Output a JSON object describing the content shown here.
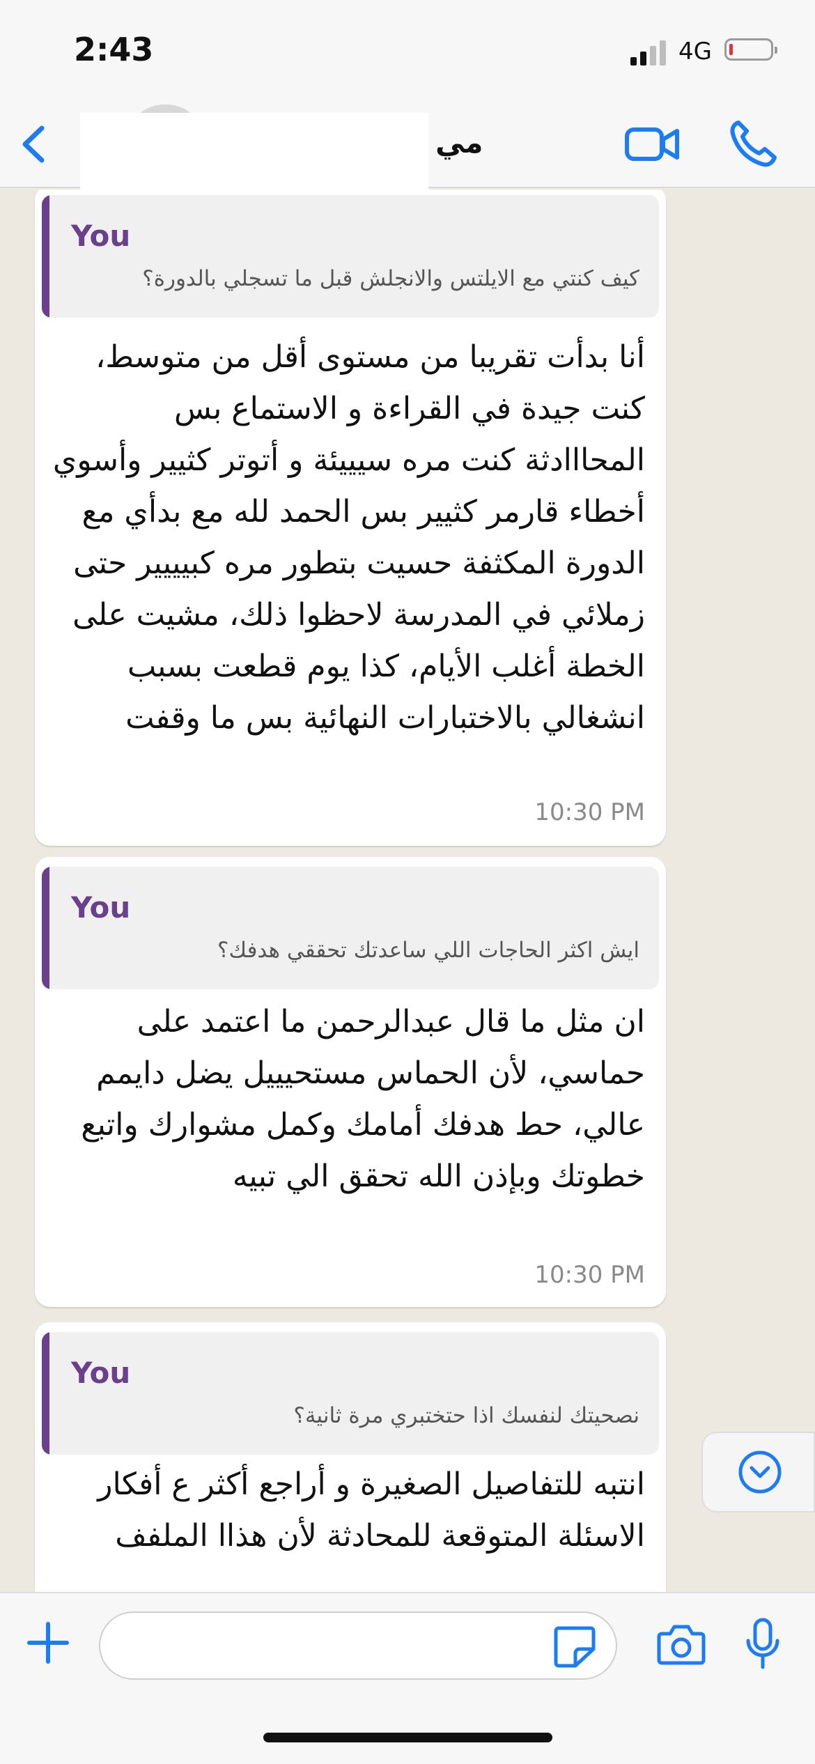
{
  "status_bar": {
    "time": "2:43",
    "network": "4G"
  },
  "header": {
    "contact_name": "مي"
  },
  "messages": [
    {
      "quote_author": "You",
      "quote_text": "كيف كنتي مع الايلتس والانجلش قبل ما تسجلي بالدورة؟",
      "text": "أنا بدأت تقريبا من مستوى أقل من متوسط، كنت جيدة في القراءة و الاستماع بس المحااادثة كنت مره سيييئة و أتوتر كثيير وأسوي أخطاء قارمر كثيير بس الحمد لله مع بدأي مع الدورة المكثفة حسيت بتطور مره كبيييير حتى زملائي في المدرسة لاحظوا ذلك، مشيت على الخطة أغلب الأيام، كذا يوم قطعت بسبب انشغالي بالاختبارات النهائية بس ما وقفت",
      "time": "10:30 PM"
    },
    {
      "quote_author": "You",
      "quote_text": "ايش اكثر الحاجات اللي ساعدتك تحققي هدفك؟",
      "text": "ان مثل ما قال عبدالرحمن ما اعتمد على حماسي، لأن الحماس مستحيييل يضل دايمم عالي، حط هدفك أمامك وكمل مشوارك واتبع خطوتك وبإذن الله تحقق الي تبيه",
      "time": "10:30 PM"
    },
    {
      "quote_author": "You",
      "quote_text": "نصحيتك لنفسك اذا حتختبري مرة ثانية؟",
      "text": "انتبه للتفاصيل الصغيرة و أراجع أكثر ع أفكار الاسئلة المتوقعة للمحادثة لأن هذاا الملفف",
      "time": ""
    }
  ]
}
